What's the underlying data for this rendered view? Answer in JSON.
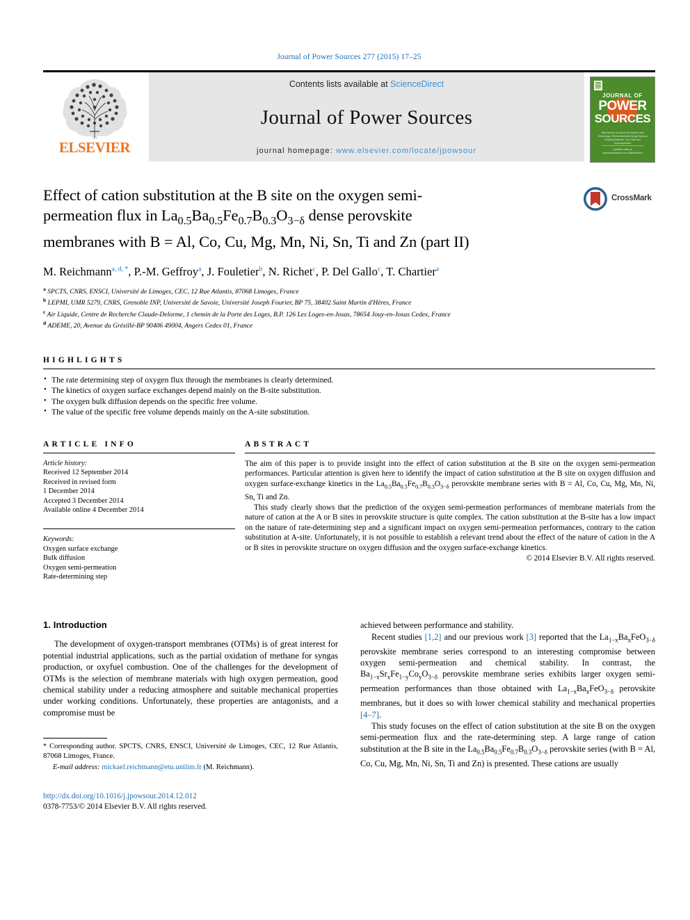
{
  "running_head": "Journal of Power Sources 277 (2015) 17–25",
  "masthead": {
    "publisher": "ELSEVIER",
    "contents_prefix": "Contents lists available at ",
    "contents_link": "ScienceDirect",
    "journal_title": "Journal of Power Sources",
    "homepage_prefix": "journal homepage: ",
    "homepage_url": "www.elsevier.com/locate/jpowsour",
    "cover": {
      "line1": "JOURNAL OF",
      "line2": "POWER",
      "line3": "SOURCES",
      "subtitle": "International Journal on the Science and Technology of Electrochemical Energy Systems including Batteries, Fuel Cells and Supercapacitors",
      "footer": "Available online at www.sciencedirect.com ScienceDirect"
    }
  },
  "article": {
    "title_line1": "Effect of cation substitution at the B site on the oxygen semi-",
    "title_line2_pre": "permeation flux in La",
    "title_sub1": "0.5",
    "title_l2a": "Ba",
    "title_sub2": "0.5",
    "title_l2b": "Fe",
    "title_sub3": "0.7",
    "title_l2c": "B",
    "title_sub4": "0.3",
    "title_l2d": "O",
    "title_sub5": "3−δ",
    "title_l2e": " dense perovskite",
    "title_line3": "membranes with B = Al, Co, Cu, Mg, Mn, Ni, Sn, Ti and Zn (part II)",
    "crossmark_label": "CrossMark",
    "authors": [
      {
        "name": "M. Reichmann",
        "marks": "a, d, *"
      },
      {
        "name": "P.-M. Geffroy",
        "marks": "a"
      },
      {
        "name": "J. Fouletier",
        "marks": "b"
      },
      {
        "name": "N. Richet",
        "marks": "c"
      },
      {
        "name": "P. Del Gallo",
        "marks": "c"
      },
      {
        "name": "T. Chartier",
        "marks": "a"
      }
    ],
    "affiliations": [
      {
        "mark": "a",
        "text": "SPCTS, CNRS, ENSCI, Université de Limoges, CEC, 12 Rue Atlantis, 87068 Limoges, France"
      },
      {
        "mark": "b",
        "text": "LEPMI, UMR 5279, CNRS, Grenoble INP, Université de Savoie, Université Joseph Fourier, BP 75, 38402 Saint Martin d'Hères, France"
      },
      {
        "mark": "c",
        "text": "Air Liquide, Centre de Recherche Claude-Delorme, 1 chemin de la Porte des Loges, B.P. 126 Les Loges-en-Josas, 78654 Jouy-en-Josas Cedex, France"
      },
      {
        "mark": "d",
        "text": "ADEME, 20, Avenue du Grésillé-BP 90406 49004, Angers Cedex 01, France"
      }
    ]
  },
  "highlights": {
    "label": "HIGHLIGHTS",
    "items": [
      "The rate determining step of oxygen flux through the membranes is clearly determined.",
      "The kinetics of oxygen surface exchanges depend mainly on the B-site substitution.",
      "The oxygen bulk diffusion depends on the specific free volume.",
      "The value of the specific free volume depends mainly on the A-site substitution."
    ]
  },
  "article_info": {
    "label": "ARTICLE INFO",
    "history_head": "Article history:",
    "history": [
      "Received 12 September 2014",
      "Received in revised form",
      "1 December 2014",
      "Accepted 3 December 2014",
      "Available online 4 December 2014"
    ],
    "keywords_head": "Keywords:",
    "keywords": [
      "Oxygen surface exchange",
      "Bulk diffusion",
      "Oxygen semi-permeation",
      "Rate-determining step"
    ]
  },
  "abstract": {
    "label": "ABSTRACT",
    "p1_a": "The aim of this paper is to provide insight into the effect of cation substitution at the B site on the oxygen semi-permeation performances. Particular attention is given here to identify the impact of cation substitution at the B site on oxygen diffusion and oxygen surface-exchange kinetics in the La",
    "p1_sub1": "0.5",
    "p1_b": "Ba",
    "p1_sub2": "0.5",
    "p1_c": "Fe",
    "p1_sub3": "0.7",
    "p1_d": "B",
    "p1_sub4": "0.3",
    "p1_e": "O",
    "p1_sub5": "3−δ",
    "p1_f": " perovskite membrane series with B = Al, Co, Cu, Mg, Mn, Ni, Sn, Ti and Zn.",
    "p2": "This study clearly shows that the prediction of the oxygen semi-permeation performances of membrane materials from the nature of cation at the A or B sites in perovskite structure is quite complex. The cation substitution at the B-site has a low impact on the nature of rate-determining step and a significant impact on oxygen semi-permeation performances, contrary to the cation substitution at A-site. Unfortunately, it is not possible to establish a relevant trend about the effect of the nature of cation in the A or B sites in perovskite structure on oxygen diffusion and the oxygen surface-exchange kinetics.",
    "copyright": "© 2014 Elsevier B.V. All rights reserved."
  },
  "introduction": {
    "heading": "1. Introduction",
    "left_p1": "The development of oxygen-transport membranes (OTMs) is of great interest for potential industrial applications, such as the partial oxidation of methane for syngas production, or oxyfuel combustion. One of the challenges for the development of OTMs is the selection of membrane materials with high oxygen permeation, good chemical stability under a reducing atmosphere and suitable mechanical properties under working conditions. Unfortunately, these properties are antagonists, and a compromise must be",
    "right_p1": "achieved between performance and stability.",
    "right_p2_a": "Recent studies ",
    "right_ref1": "[1,2]",
    "right_p2_b": " and our previous work ",
    "right_ref2": "[3]",
    "right_p2_c": " reported that the La",
    "right_sub_1mx": "1−x",
    "right_p2_d": "Ba",
    "right_sub_x": "x",
    "right_p2_e": "FeO",
    "right_sub_3d": "3−δ",
    "right_p2_f": " perovskite membrane series correspond to an interesting compromise between oxygen semi-permeation and chemical stability. In contrast, the Ba",
    "right_sub_1mx2": "1−x",
    "right_p2_g": "Sr",
    "right_sub_x2": "x",
    "right_p2_h": "Fe",
    "right_sub_1my": "1−y",
    "right_p2_i": "Co",
    "right_sub_y": "y",
    "right_p2_j": "O",
    "right_sub_3d2": "3−δ",
    "right_p2_k": " perovskite membrane series exhibits larger oxygen semi-permeation performances than those obtained with La",
    "right_sub_1mx3": "1−x",
    "right_p2_l": "Ba",
    "right_sub_x3": "x",
    "right_p2_m": "FeO",
    "right_sub_3d3": "3−δ",
    "right_p2_n": " perovskite membranes, but it does so with lower chemical stability and mechanical properties ",
    "right_ref3": "[4–7]",
    "right_p2_o": ".",
    "right_p3_a": "This study focuses on the effect of cation substitution at the site B on the oxygen semi-permeation flux and the rate-determining step. A large range of cation substitution at the B site in the La",
    "right_p3_sub1": "0.5",
    "right_p3_b": "Ba",
    "right_p3_sub2": "0.5",
    "right_p3_c": "Fe",
    "right_p3_sub3": "0.7",
    "right_p3_d": "B",
    "right_p3_sub4": "0.3",
    "right_p3_e": "O",
    "right_p3_sub5": "3−δ",
    "right_p3_f": " perovskite series (with B = Al, Co, Cu, Mg, Mn, Ni, Sn, Ti and Zn) is presented. These cations are usually"
  },
  "footnote": {
    "star": "*",
    "text": " Corresponding author. SPCTS, CNRS, ENSCI, Université de Limoges, CEC, 12 Rue Atlantis, 87068 Limoges, France.",
    "email_label": "E-mail address:",
    "email": "mickael.reichmann@etu.unilim.fr",
    "email_suffix": " (M. Reichmann)."
  },
  "doi_block": {
    "doi": "http://dx.doi.org/10.1016/j.jpowsour.2014.12.012",
    "issn": "0378-7753/© 2014 Elsevier B.V. All rights reserved."
  },
  "colors": {
    "link": "#1a6fb5",
    "elsevier_orange": "#E87722",
    "band_gray": "#e6e6e6",
    "cover_green": "#4c8c2b"
  }
}
